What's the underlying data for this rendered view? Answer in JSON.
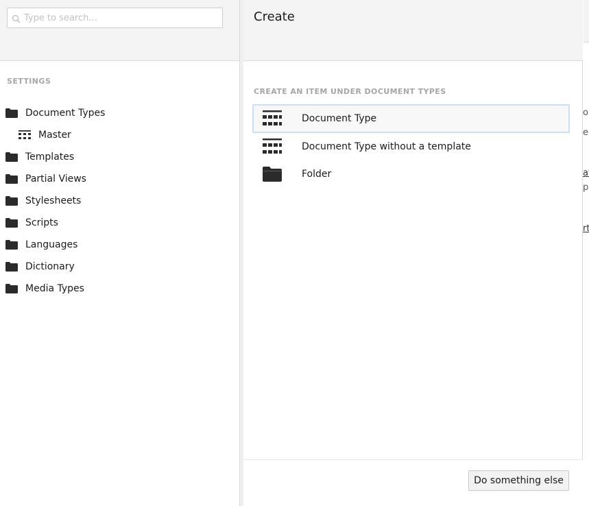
{
  "tree": {
    "search": {
      "placeholder": "Type to search...",
      "value": ""
    },
    "section_label": "SETTINGS",
    "items": [
      {
        "label": "Document Types",
        "icon": "folder-icon"
      },
      {
        "label": "Master",
        "icon": "doctype-icon"
      },
      {
        "label": "Templates",
        "icon": "folder-icon"
      },
      {
        "label": "Partial Views",
        "icon": "folder-icon"
      },
      {
        "label": "Stylesheets",
        "icon": "folder-icon"
      },
      {
        "label": "Scripts",
        "icon": "folder-icon"
      },
      {
        "label": "Languages",
        "icon": "folder-icon"
      },
      {
        "label": "Dictionary",
        "icon": "folder-icon"
      },
      {
        "label": "Media Types",
        "icon": "folder-icon"
      }
    ]
  },
  "dialog": {
    "title": "Create",
    "section_label": "CREATE AN ITEM UNDER DOCUMENT TYPES",
    "options": [
      {
        "label": "Document Type",
        "icon": "doctype-icon",
        "selected": true
      },
      {
        "label": "Document Type without a template",
        "icon": "doctype-icon",
        "selected": false
      },
      {
        "label": "Folder",
        "icon": "folder-icon",
        "selected": false
      }
    ],
    "footer_button": "Do something else"
  },
  "background_peek": [
    "o",
    "e",
    "at",
    "p",
    "rt"
  ],
  "colors": {
    "panel_header": "#f3f3f3",
    "muted_label": "#a6a6a6",
    "selected_border": "#c9dff3",
    "icon": "#2b2b2b"
  }
}
